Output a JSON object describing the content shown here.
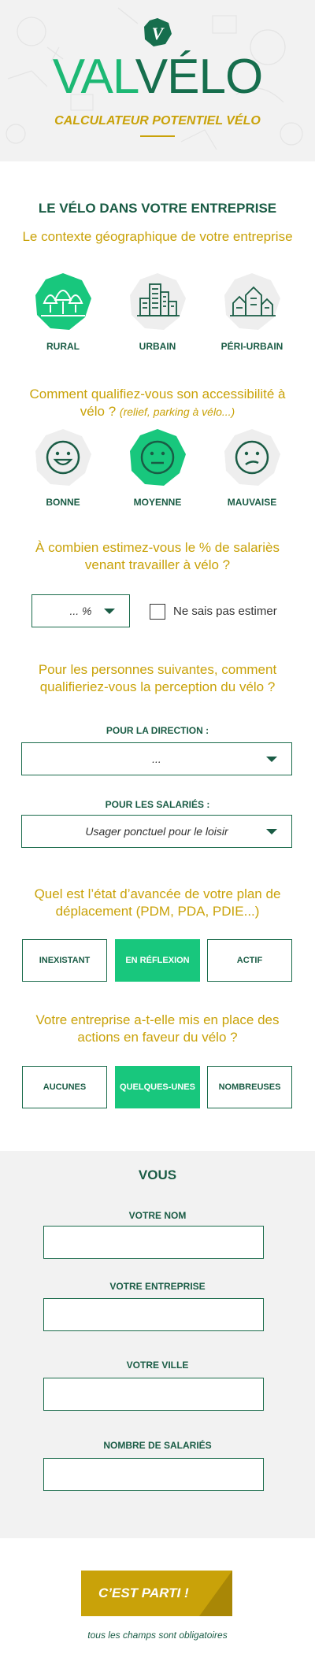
{
  "header": {
    "badge_letter": "V",
    "logo_val": "VAL",
    "logo_velo": "VÉLO",
    "subtitle": "CALCULATEUR POTENTIEL VÉLO"
  },
  "company": {
    "title": "LE VÉLO DANS VOTRE ENTREPRISE",
    "q_context": "Le contexte géographique de votre entreprise",
    "context_options": [
      {
        "label": "RURAL",
        "icon": "trees-icon",
        "selected": true
      },
      {
        "label": "URBAIN",
        "icon": "city-buildings-icon",
        "selected": false
      },
      {
        "label": "PÉRI-URBAIN",
        "icon": "houses-icon",
        "selected": false
      }
    ],
    "q_access": "Comment qualifiez-vous son accessibilité à vélo ?",
    "q_access_note": "(relief, parking à vélo...)",
    "access_options": [
      {
        "label": "BONNE",
        "icon": "happy-face-icon",
        "selected": false
      },
      {
        "label": "MOYENNE",
        "icon": "neutral-face-icon",
        "selected": true
      },
      {
        "label": "MAUVAISE",
        "icon": "sad-face-icon",
        "selected": false
      }
    ],
    "q_percent": "À combien estimez-vous le % de salariès venant travailler à vélo ?",
    "percent_value": "... %",
    "percent_unknown_label": "Ne sais pas estimer",
    "q_perception": "Pour les personnes suivantes, comment qualifieriez-vous la perception du vélo ?",
    "direction_label": "POUR LA DIRECTION :",
    "direction_value": "...",
    "employees_label": "POUR LES SALARIÉS :",
    "employees_value": "Usager ponctuel pour le loisir",
    "q_plan": "Quel est l’état d’avancée de votre plan de déplacement (PDM, PDA, PDIE...)",
    "plan_options": [
      {
        "label": "INEXISTANT",
        "selected": false
      },
      {
        "label": "EN RÉFLEXION",
        "selected": true
      },
      {
        "label": "ACTIF",
        "selected": false
      }
    ],
    "q_actions": "Votre entreprise a-t-elle mis en place des actions en faveur du vélo ?",
    "actions_options": [
      {
        "label": "AUCUNES",
        "selected": false
      },
      {
        "label": "QUELQUES-UNES",
        "selected": true
      },
      {
        "label": "NOMBREUSES",
        "selected": false
      }
    ]
  },
  "you": {
    "title": "VOUS",
    "name_label": "VOTRE NOM",
    "company_label": "VOTRE ENTREPRISE",
    "city_label": "VOTRE VILLE",
    "employees_count_label": "NOMBRE DE SALARIÉS"
  },
  "submit": {
    "label": "C’EST PARTI !",
    "footnote": "tous les champs sont obligatoires"
  },
  "colors": {
    "green_dark": "#1a5c45",
    "green_accent": "#18c77d",
    "gold": "#c9a209",
    "light_bg": "#f2f2f2"
  }
}
